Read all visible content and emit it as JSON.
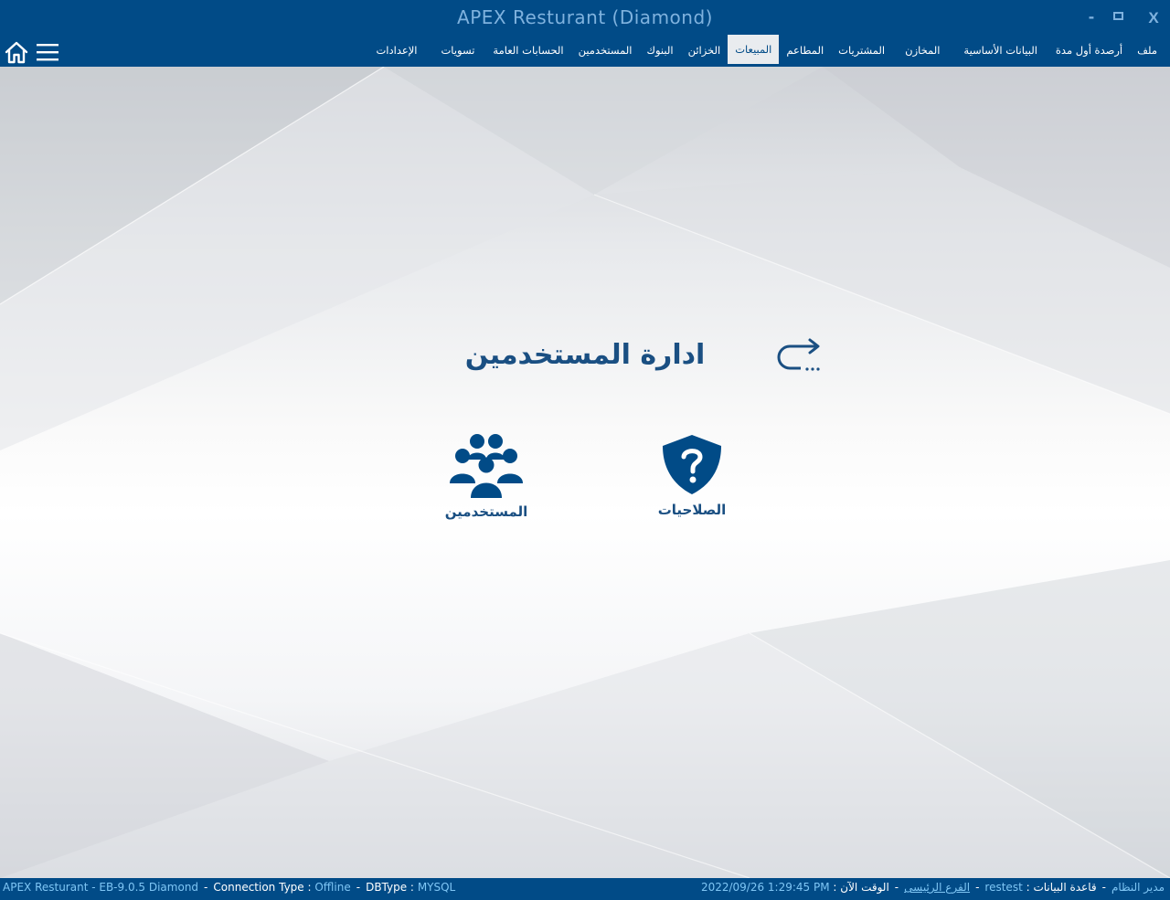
{
  "window": {
    "title": "APEX Resturant (Diamond)",
    "minimize_label": "-",
    "close_label": "X"
  },
  "menu": {
    "tabs": [
      {
        "label": "ملف",
        "active": false
      },
      {
        "label": "أرصدة أول مدة",
        "active": false
      },
      {
        "label": "البيانات الأساسية",
        "active": false
      },
      {
        "label": "المخازن",
        "active": false
      },
      {
        "label": "المشتريات",
        "active": false
      },
      {
        "label": "المطاعم",
        "active": false
      },
      {
        "label": "المبيعات",
        "active": true
      },
      {
        "label": "الخزائن",
        "active": false
      },
      {
        "label": "البنوك",
        "active": false
      },
      {
        "label": "المستخدمين",
        "active": false
      },
      {
        "label": "الحسابات العامة",
        "active": false
      },
      {
        "label": "تسويات",
        "active": false
      },
      {
        "label": "الإعدادات",
        "active": false
      }
    ]
  },
  "page": {
    "title": "ادارة المستخدمين",
    "tiles": {
      "permissions": {
        "label": "الصلاحيات",
        "icon": "shield-question-icon"
      },
      "users": {
        "label": "المستخدمين",
        "icon": "users-group-icon"
      }
    }
  },
  "status": {
    "app": "APEX Resturant - EB-9.0.5  Diamond",
    "connection_label": "Connection Type :",
    "connection_value": "Offline",
    "dbtype_label": "DBType :",
    "dbtype_value": "MYSQL",
    "user": "مدير النظام",
    "database_label": "قاعدة البيانات :",
    "database_value": "restest",
    "branch": "الفرع الرئيسى",
    "time_label": "الوقت الآن :",
    "time_value": "2022/09/26 1:29:45 PM"
  },
  "colors": {
    "primary": "#014b87",
    "accent": "#7fc6f5",
    "title_text": "#7fb2de",
    "content_text": "#1a4f82"
  }
}
